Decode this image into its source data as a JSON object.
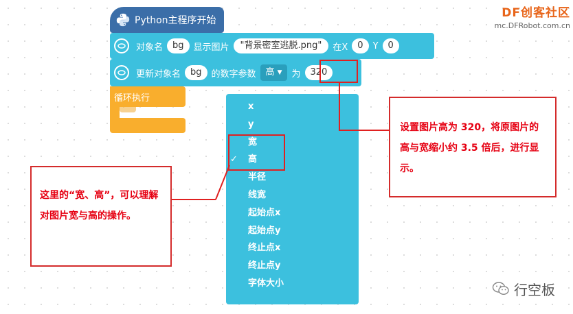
{
  "logo": {
    "brand": "DF创客社区",
    "site": "mc.DFRobot.com.cn"
  },
  "hat_block": {
    "label": "Python主程序开始"
  },
  "block_show_image": {
    "label_obj": "对象名",
    "obj": "bg",
    "label_show": "显示图片",
    "file": "\"背景密室逃脱.png\"",
    "label_x": "在X",
    "x": "0",
    "label_y": "Y",
    "y": "0"
  },
  "block_update": {
    "label_update": "更新对象名",
    "obj": "bg",
    "label_param": "的数字参数",
    "param": "高",
    "label_to": "为",
    "value": "320"
  },
  "loop_block": {
    "label": "循环执行"
  },
  "dropdown": {
    "selected": "高",
    "check": "✓",
    "items": [
      "x",
      "y",
      "宽",
      "高",
      "半径",
      "线宽",
      "起始点x",
      "起始点y",
      "终止点x",
      "终止点y",
      "字体大小"
    ]
  },
  "notes": {
    "right": "设置图片高为 320，将原图片的高与宽缩小约 3.5 倍后，进行显示。",
    "left": "这里的“宽、高”，可以理解对图片宽与高的操作。"
  },
  "watermark": {
    "text": "行空板"
  },
  "colors": {
    "hat": "#3b6ea8",
    "block": "#3cc0de",
    "dropdown_field": "#2a9fbc",
    "loop": "#f9ae2d",
    "annotation": "#e02020",
    "note_text": "#e60012",
    "brand": "#e8651a"
  },
  "icons": {
    "hat": "python-logo-icon",
    "block": "ring-icon",
    "dropdown": "caret-down-icon",
    "watermark": "wechat-icon"
  }
}
